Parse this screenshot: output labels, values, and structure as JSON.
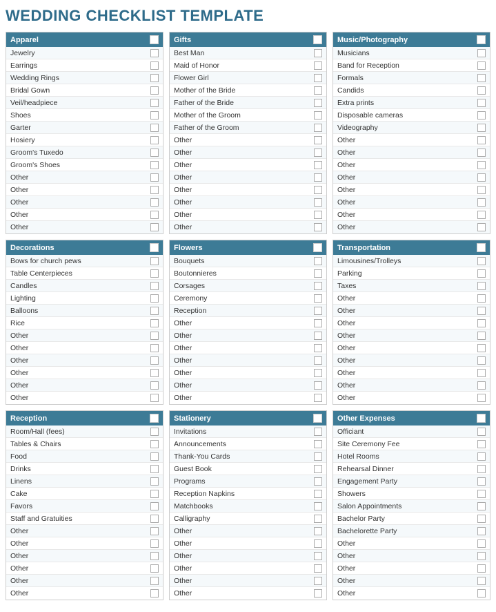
{
  "title": "WEDDING CHECKLIST TEMPLATE",
  "sections": [
    {
      "id": "apparel",
      "header": "Apparel",
      "items": [
        "Jewelry",
        "Earrings",
        "Wedding Rings",
        "Bridal Gown",
        "Veil/headpiece",
        "Shoes",
        "Garter",
        "Hosiery",
        "Groom's Tuxedo",
        "Groom's Shoes",
        "Other",
        "Other",
        "Other",
        "Other",
        "Other"
      ]
    },
    {
      "id": "gifts",
      "header": "Gifts",
      "items": [
        "Best Man",
        "Maid of Honor",
        "Flower Girl",
        "Mother of the Bride",
        "Father of the Bride",
        "Mother of the Groom",
        "Father of the Groom",
        "Other",
        "Other",
        "Other",
        "Other",
        "Other",
        "Other",
        "Other",
        "Other"
      ]
    },
    {
      "id": "music-photography",
      "header": "Music/Photography",
      "items": [
        "Musicians",
        "Band for Reception",
        "Formals",
        "Candids",
        "Extra prints",
        "Disposable cameras",
        "Videography",
        "Other",
        "Other",
        "Other",
        "Other",
        "Other",
        "Other",
        "Other",
        "Other"
      ]
    },
    {
      "id": "decorations",
      "header": "Decorations",
      "items": [
        "Bows for church pews",
        "Table Centerpieces",
        "Candles",
        "Lighting",
        "Balloons",
        "Rice",
        "Other",
        "Other",
        "Other",
        "Other",
        "Other",
        "Other"
      ]
    },
    {
      "id": "flowers",
      "header": "Flowers",
      "items": [
        "Bouquets",
        "Boutonnieres",
        "Corsages",
        "Ceremony",
        "Reception",
        "Other",
        "Other",
        "Other",
        "Other",
        "Other",
        "Other",
        "Other"
      ]
    },
    {
      "id": "transportation",
      "header": "Transportation",
      "items": [
        "Limousines/Trolleys",
        "Parking",
        "Taxes",
        "Other",
        "Other",
        "Other",
        "Other",
        "Other",
        "Other",
        "Other",
        "Other",
        "Other"
      ]
    },
    {
      "id": "reception",
      "header": "Reception",
      "items": [
        "Room/Hall (fees)",
        "Tables & Chairs",
        "Food",
        "Drinks",
        "Linens",
        "Cake",
        "Favors",
        "Staff and Gratuities",
        "Other",
        "Other",
        "Other",
        "Other",
        "Other",
        "Other"
      ]
    },
    {
      "id": "stationery",
      "header": "Stationery",
      "items": [
        "Invitations",
        "Announcements",
        "Thank-You Cards",
        "Guest Book",
        "Programs",
        "Reception Napkins",
        "Matchbooks",
        "Calligraphy",
        "Other",
        "Other",
        "Other",
        "Other",
        "Other",
        "Other"
      ]
    },
    {
      "id": "other-expenses",
      "header": "Other Expenses",
      "items": [
        "Officiant",
        "Site Ceremony Fee",
        "Hotel Rooms",
        "Rehearsal Dinner",
        "Engagement Party",
        "Showers",
        "Salon Appointments",
        "Bachelor Party",
        "Bachelorette Party",
        "Other",
        "Other",
        "Other",
        "Other",
        "Other"
      ]
    }
  ]
}
